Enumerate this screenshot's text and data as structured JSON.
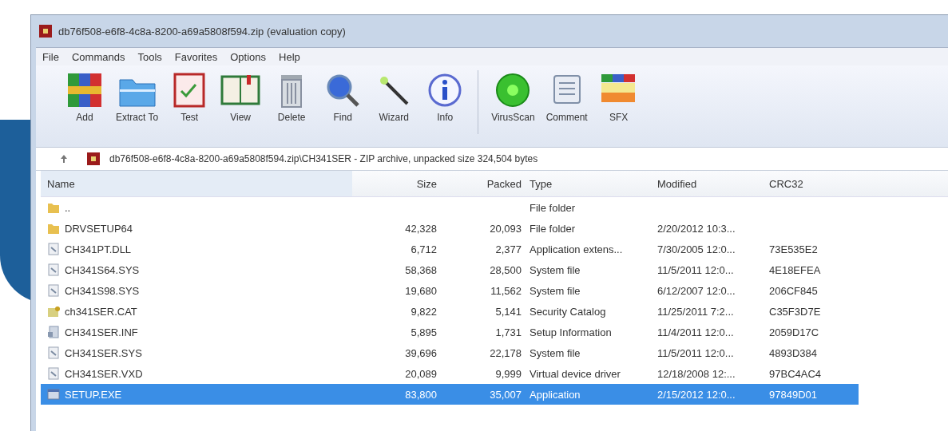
{
  "window": {
    "title": "db76f508-e6f8-4c8a-8200-a69a5808f594.zip (evaluation copy)"
  },
  "menu": [
    "File",
    "Commands",
    "Tools",
    "Favorites",
    "Options",
    "Help"
  ],
  "toolbar": [
    {
      "label": "Add"
    },
    {
      "label": "Extract To"
    },
    {
      "label": "Test"
    },
    {
      "label": "View"
    },
    {
      "label": "Delete"
    },
    {
      "label": "Find"
    },
    {
      "label": "Wizard"
    },
    {
      "label": "Info"
    },
    {
      "label": "VirusScan"
    },
    {
      "label": "Comment"
    },
    {
      "label": "SFX"
    }
  ],
  "address": "db76f508-e6f8-4c8a-8200-a69a5808f594.zip\\CH341SER - ZIP archive, unpacked size 324,504 bytes",
  "table": {
    "columns": [
      "Name",
      "Size",
      "Packed",
      "Type",
      "Modified",
      "CRC32"
    ],
    "rows": [
      {
        "kind": "folder",
        "name": "..",
        "size": "",
        "packed": "",
        "type": "File folder",
        "modified": "",
        "crc": "",
        "selected": false
      },
      {
        "kind": "folder",
        "name": "DRVSETUP64",
        "size": "42,328",
        "packed": "20,093",
        "type": "File folder",
        "modified": "2/20/2012 10:3...",
        "crc": "",
        "selected": false
      },
      {
        "kind": "file",
        "name": "CH341PT.DLL",
        "size": "6,712",
        "packed": "2,377",
        "type": "Application extens...",
        "modified": "7/30/2005 12:0...",
        "crc": "73E535E2",
        "selected": false
      },
      {
        "kind": "file",
        "name": "CH341S64.SYS",
        "size": "58,368",
        "packed": "28,500",
        "type": "System file",
        "modified": "11/5/2011 12:0...",
        "crc": "4E18EFEA",
        "selected": false
      },
      {
        "kind": "file",
        "name": "CH341S98.SYS",
        "size": "19,680",
        "packed": "11,562",
        "type": "System file",
        "modified": "6/12/2007 12:0...",
        "crc": "206CF845",
        "selected": false
      },
      {
        "kind": "catalog",
        "name": "ch341SER.CAT",
        "size": "9,822",
        "packed": "5,141",
        "type": "Security Catalog",
        "modified": "11/25/2011 7:2...",
        "crc": "C35F3D7E",
        "selected": false
      },
      {
        "kind": "info",
        "name": "CH341SER.INF",
        "size": "5,895",
        "packed": "1,731",
        "type": "Setup Information",
        "modified": "11/4/2011 12:0...",
        "crc": "2059D17C",
        "selected": false
      },
      {
        "kind": "file",
        "name": "CH341SER.SYS",
        "size": "39,696",
        "packed": "22,178",
        "type": "System file",
        "modified": "11/5/2011 12:0...",
        "crc": "4893D384",
        "selected": false
      },
      {
        "kind": "file",
        "name": "CH341SER.VXD",
        "size": "20,089",
        "packed": "9,999",
        "type": "Virtual device driver",
        "modified": "12/18/2008 12:...",
        "crc": "97BC4AC4",
        "selected": false
      },
      {
        "kind": "app",
        "name": "SETUP.EXE",
        "size": "83,800",
        "packed": "35,007",
        "type": "Application",
        "modified": "2/15/2012 12:0...",
        "crc": "97849D01",
        "selected": true
      }
    ]
  }
}
